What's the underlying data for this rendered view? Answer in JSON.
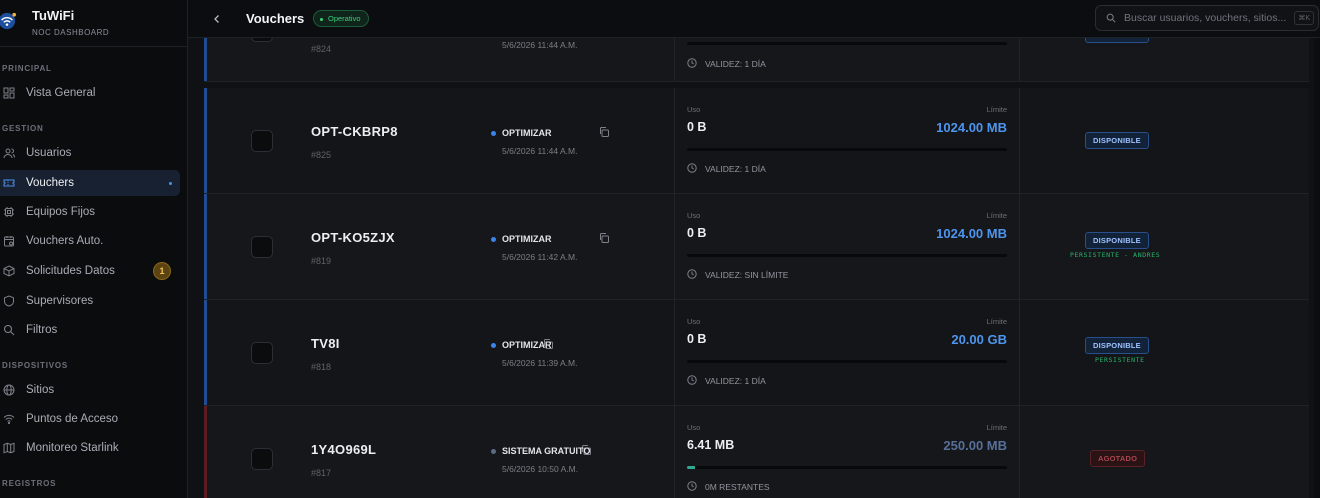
{
  "brand": {
    "title": "TuWiFi",
    "subtitle": "NOC DASHBOARD"
  },
  "sidebar": {
    "sections": [
      {
        "label": "PRINCIPAL",
        "items": [
          {
            "label": "Vista General",
            "icon": "grid-icon"
          }
        ]
      },
      {
        "label": "GESTION",
        "items": [
          {
            "label": "Usuarios",
            "icon": "users-icon"
          },
          {
            "label": "Vouchers",
            "icon": "ticket-icon",
            "active": true
          },
          {
            "label": "Equipos Fijos",
            "icon": "chip-icon"
          },
          {
            "label": "Vouchers Auto.",
            "icon": "calendar-icon"
          },
          {
            "label": "Solicitudes Datos",
            "icon": "box-icon",
            "badge": "1"
          },
          {
            "label": "Supervisores",
            "icon": "shield-icon"
          },
          {
            "label": "Filtros",
            "icon": "search-icon"
          }
        ]
      },
      {
        "label": "DISPOSITIVOS",
        "items": [
          {
            "label": "Sitios",
            "icon": "globe-icon"
          },
          {
            "label": "Puntos de Acceso",
            "icon": "wifi-icon"
          },
          {
            "label": "Monitoreo Starlink",
            "icon": "map-icon"
          }
        ]
      },
      {
        "label": "REGISTROS",
        "items": []
      }
    ]
  },
  "header": {
    "title": "Vouchers",
    "status": "Operativo",
    "search_placeholder": "Buscar usuarios, vouchers, sitios...",
    "shortcut": "⌘K"
  },
  "vouchers": [
    {
      "code": "",
      "id": "#824",
      "plan": "",
      "date": "5/6/2026 11:44 A.M.",
      "uso_label": "",
      "limite_label": "",
      "uso": "",
      "limite": "",
      "progress": 0,
      "validity": "VALIDEZ: 1 DÍA",
      "status": "",
      "tag": "",
      "accent": "blue"
    },
    {
      "code": "OPT-CKBRP8",
      "id": "#825",
      "plan": "OPTIMIZAR",
      "date": "5/6/2026 11:44 A.M.",
      "uso_label": "Uso",
      "limite_label": "Límite",
      "uso": "0 B",
      "limite": "1024.00 MB",
      "progress": 0,
      "validity": "VALIDEZ: 1 DÍA",
      "status": "DISPONIBLE",
      "tag": "",
      "accent": "blue"
    },
    {
      "code": "OPT-KO5ZJX",
      "id": "#819",
      "plan": "OPTIMIZAR",
      "date": "5/6/2026 11:42 A.M.",
      "uso_label": "Uso",
      "limite_label": "Límite",
      "uso": "0 B",
      "limite": "1024.00 MB",
      "progress": 0,
      "validity": "VALIDEZ: SIN LÍMITE",
      "status": "DISPONIBLE",
      "tag": "PERSISTENTE - ANDRES",
      "accent": "blue"
    },
    {
      "code": "TV8I",
      "id": "#818",
      "plan": "OPTIMIZAR",
      "date": "5/6/2026 11:39 A.M.",
      "uso_label": "Uso",
      "limite_label": "Límite",
      "uso": "0 B",
      "limite": "20.00 GB",
      "progress": 0,
      "validity": "VALIDEZ: 1 DÍA",
      "status": "DISPONIBLE",
      "tag": "PERSISTENTE",
      "accent": "blue"
    },
    {
      "code": "1Y4O969L",
      "id": "#817",
      "plan": "SISTEMA GRATUITO",
      "date": "5/6/2026 10:50 A.M.",
      "uso_label": "Uso",
      "limite_label": "Límite",
      "uso": "6.41 MB",
      "limite": "250.00 MB",
      "progress": 0.026,
      "validity": "0M RESTANTES",
      "status": "AGOTADO",
      "tag": "",
      "accent": "red"
    }
  ]
}
